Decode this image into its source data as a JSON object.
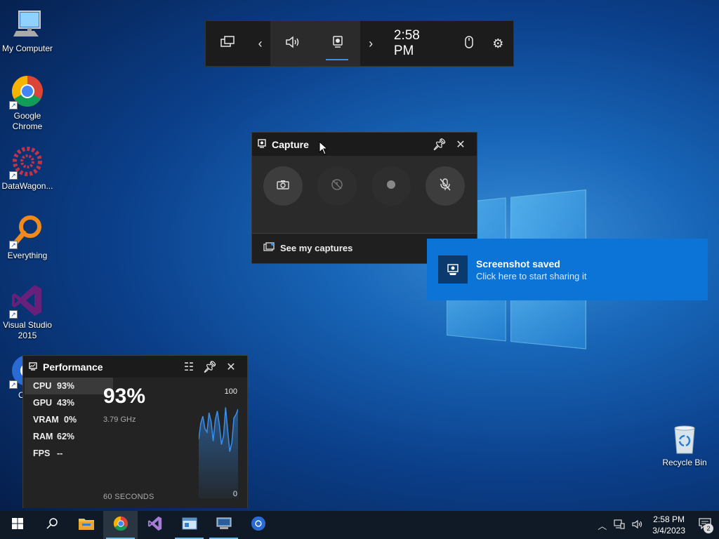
{
  "desktop": {
    "icons": [
      {
        "label": "My Computer"
      },
      {
        "label": "Google Chrome"
      },
      {
        "label": "DataWagon..."
      },
      {
        "label": "Everything"
      },
      {
        "label": "Visual Studio 2015"
      },
      {
        "label": "Chro"
      }
    ],
    "recycle_bin": {
      "label": "Recycle Bin"
    }
  },
  "game_bar": {
    "time": "2:58 PM",
    "buttons": [
      "widget-menu-icon",
      "chevron-left-icon",
      "audio-icon",
      "capture-icon",
      "chevron-right-icon",
      "mouse-icon",
      "settings-icon"
    ]
  },
  "capture": {
    "title": "Capture",
    "see_captures": "See my captures",
    "buttons": [
      "camera-icon",
      "record-last-icon",
      "record-icon",
      "mic-off-icon"
    ]
  },
  "toast": {
    "title": "Screenshot saved",
    "subtitle": "Click here to start sharing it"
  },
  "performance": {
    "title": "Performance",
    "metrics": [
      {
        "name": "CPU",
        "value": "93%"
      },
      {
        "name": "GPU",
        "value": "43%"
      },
      {
        "name": "VRAM",
        "value": "0%"
      },
      {
        "name": "RAM",
        "value": "62%"
      },
      {
        "name": "FPS",
        "value": "--"
      }
    ],
    "big_value": "93%",
    "clock": "3.79 GHz",
    "window": "60 SECONDS",
    "scale_max": "100",
    "scale_min": "0",
    "graph_values": [
      62,
      80,
      88,
      74,
      70,
      92,
      82,
      60,
      84,
      94,
      78,
      56,
      66,
      98,
      72,
      48,
      58,
      86,
      90,
      96
    ]
  },
  "taskbar": {
    "clock_time": "2:58 PM",
    "clock_date": "3/4/2023",
    "notification_count": "2"
  },
  "colors": {
    "accent": "#0b74d6",
    "graph_line": "#3b8eea"
  }
}
